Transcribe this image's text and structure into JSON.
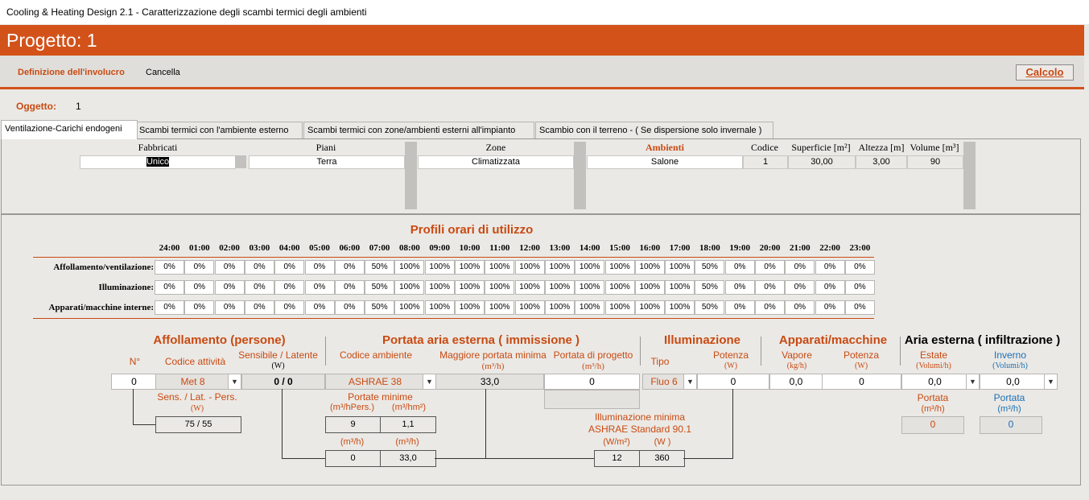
{
  "window": {
    "title": "Cooling & Heating Design 2.1 - Caratterizzazione degli scambi termici degli ambienti"
  },
  "header": {
    "title": "Progetto: 1"
  },
  "toolbar": {
    "definizione": "Definizione dell'involucro",
    "cancella": "Cancella",
    "calcolo": "Calcolo"
  },
  "oggetto": {
    "label": "Oggetto:",
    "value": "1"
  },
  "tabs": [
    "Ventilazione-Carichi endogeni",
    "Scambi termici con l'ambiente esterno",
    "Scambi termici con zone/ambienti esterni all'impianto",
    "Scambio con il terreno - ( Se dispersione solo invernale )"
  ],
  "top": {
    "fabbricati": "Fabbricati",
    "fabbricati_val": "Unico",
    "piani": "Piani",
    "piani_val": "Terra",
    "zone": "Zone",
    "zone_val": "Climatizzata",
    "ambienti": "Ambienti",
    "ambienti_val": "Salone",
    "codice": "Codice",
    "codice_val": "1",
    "superficie": "Superficie [m²]",
    "superficie_val": "30,00",
    "altezza": "Altezza [m]",
    "altezza_val": "3,00",
    "volume": "Volume [m³]",
    "volume_val": "90"
  },
  "profili": {
    "title": "Profili orari di utilizzo",
    "hours": [
      "24:00",
      "01:00",
      "02:00",
      "03:00",
      "04:00",
      "05:00",
      "06:00",
      "07:00",
      "08:00",
      "09:00",
      "10:00",
      "11:00",
      "12:00",
      "13:00",
      "14:00",
      "15:00",
      "16:00",
      "17:00",
      "18:00",
      "19:00",
      "20:00",
      "21:00",
      "22:00",
      "23:00"
    ],
    "rows": [
      {
        "label": "Affollamento/ventilazione:",
        "values": [
          "0%",
          "0%",
          "0%",
          "0%",
          "0%",
          "0%",
          "0%",
          "50%",
          "100%",
          "100%",
          "100%",
          "100%",
          "100%",
          "100%",
          "100%",
          "100%",
          "100%",
          "100%",
          "50%",
          "0%",
          "0%",
          "0%",
          "0%",
          "0%"
        ]
      },
      {
        "label": "Illuminazione:",
        "values": [
          "0%",
          "0%",
          "0%",
          "0%",
          "0%",
          "0%",
          "0%",
          "50%",
          "100%",
          "100%",
          "100%",
          "100%",
          "100%",
          "100%",
          "100%",
          "100%",
          "100%",
          "100%",
          "50%",
          "0%",
          "0%",
          "0%",
          "0%",
          "0%"
        ]
      },
      {
        "label": "Apparati/macchine interne:",
        "values": [
          "0%",
          "0%",
          "0%",
          "0%",
          "0%",
          "0%",
          "0%",
          "50%",
          "100%",
          "100%",
          "100%",
          "100%",
          "100%",
          "100%",
          "100%",
          "100%",
          "100%",
          "100%",
          "50%",
          "0%",
          "0%",
          "0%",
          "0%",
          "0%"
        ]
      }
    ]
  },
  "bottom": {
    "affollamento": "Affollamento (persone)",
    "portata_aria": "Portata aria esterna ( immissione )",
    "illuminazione": "Illuminazione",
    "apparati": "Apparati/macchine",
    "aria_esterna": "Aria esterna ( infiltrazione )",
    "n_label": "N°",
    "codice_attivita": "Codice attività",
    "sensibile_latente": "Sensibile / Latente",
    "unit_w": "(W)",
    "codice_ambiente": "Codice ambiente",
    "maggiore_portata": "Maggiore portata minima",
    "unit_m3h": "(m³/h)",
    "portata_progetto": "Portata di progetto",
    "tipo": "Tipo",
    "potenza": "Potenza",
    "vapore": "Vapore",
    "unit_kgh": "(kg/h)",
    "estate": "Estate",
    "inverno": "Inverno",
    "unit_volumi": "(Volumi/h)",
    "n_val": "0",
    "met_val": "Met 8",
    "sens_lat_val": "0 / 0",
    "ashrae_val": "ASHRAE 38",
    "magg_portata_val": "33,0",
    "portata_prog_val": "0",
    "fluo_val": "Fluo 6",
    "potenza_ill_val": "0",
    "vapore_val": "0,0",
    "potenza_app_val": "0",
    "estate_val": "0,0",
    "inverno_val": "0,0",
    "sens_lat_pers": "Sens. / Lat. - Pers.",
    "sens_lat_pers_val": "75 / 55",
    "portate_minime": "Portate minime",
    "unit_m3hpers": "(m³/hPers.)",
    "unit_m3hm2": "(m³/hm²)",
    "pm_pers_val": "9",
    "pm_m2_val": "1,1",
    "pm_a_val": "0",
    "pm_b_val": "33,0",
    "ill_minima": "Illuminazione minima",
    "ashrae_std": "ASHRAE Standard 90.1",
    "unit_wm2": "(W/m²)",
    "unit_w2": "(W )",
    "ill_wm2_val": "12",
    "ill_w_val": "360",
    "portata": "Portata",
    "portata_estate_val": "0",
    "portata_inverno_val": "0"
  }
}
